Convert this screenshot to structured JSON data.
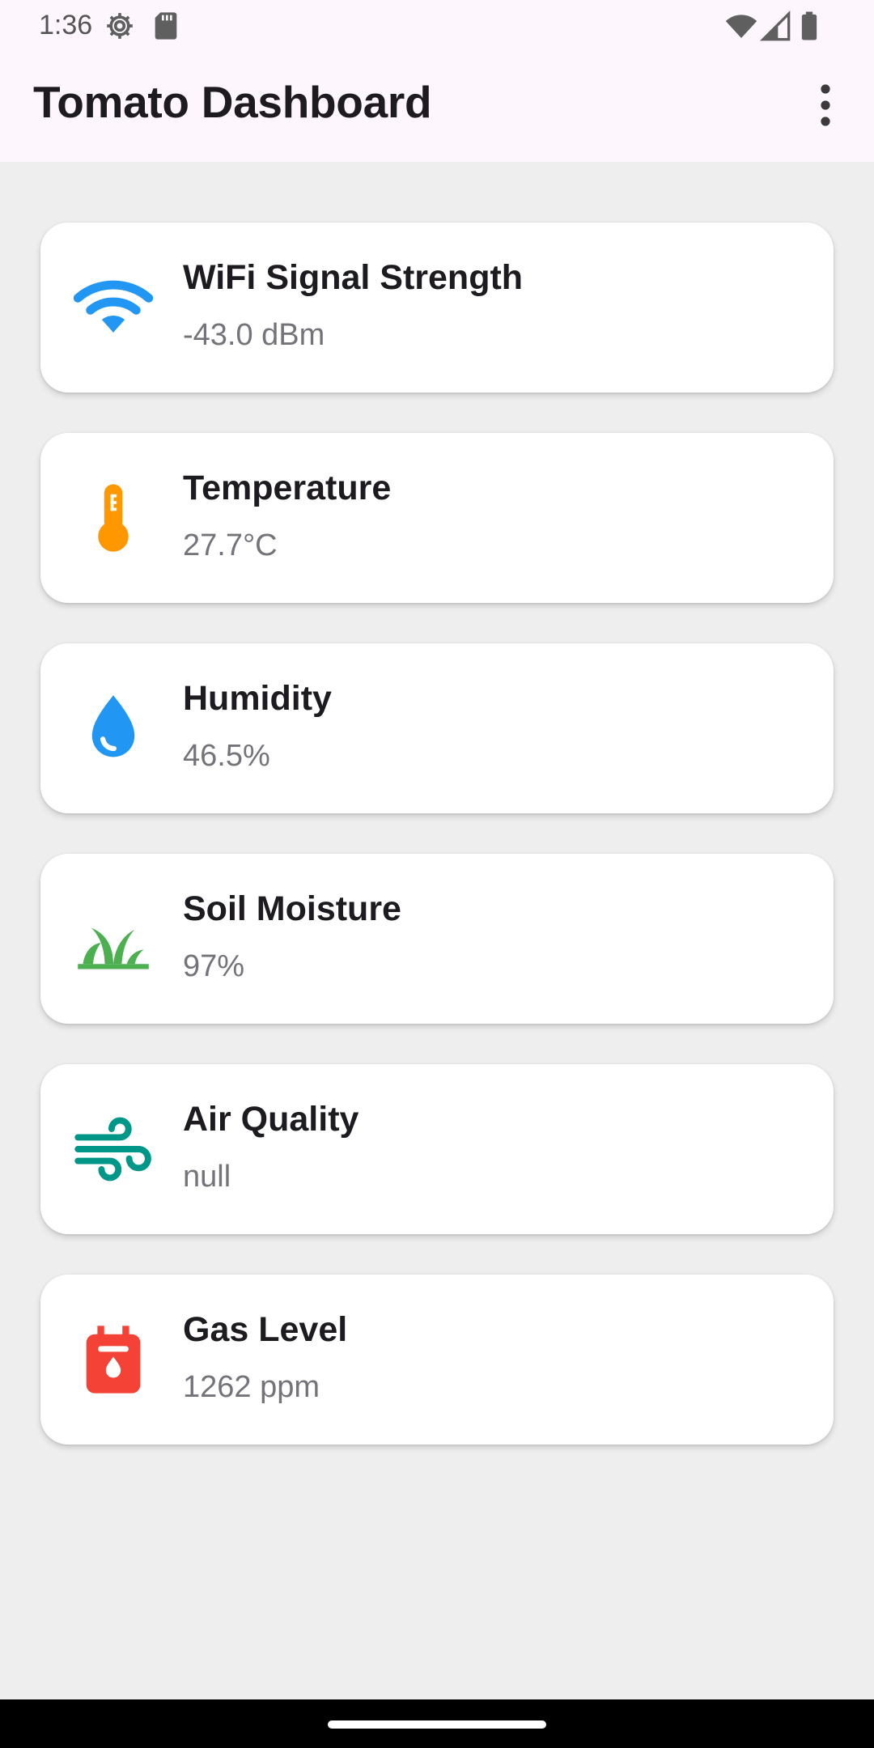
{
  "status_bar": {
    "time": "1:36",
    "icons": [
      "gear-icon",
      "sd-card-icon",
      "wifi-icon",
      "cell-signal-icon",
      "battery-icon"
    ]
  },
  "app_bar": {
    "title": "Tomato Dashboard",
    "menu_icon": "more-vertical-icon"
  },
  "colors": {
    "wifi": "#2196f3",
    "temperature": "#ff9800",
    "humidity": "#2196f3",
    "soil": "#4caf50",
    "air": "#009688",
    "gas": "#f44336"
  },
  "cards": [
    {
      "title": "WiFi Signal Strength",
      "value": "-43.0 dBm",
      "icon": "wifi-icon"
    },
    {
      "title": "Temperature",
      "value": "27.7°C",
      "icon": "thermometer-icon"
    },
    {
      "title": "Humidity",
      "value": "46.5%",
      "icon": "water-drop-icon"
    },
    {
      "title": "Soil Moisture",
      "value": "97%",
      "icon": "grass-icon"
    },
    {
      "title": "Air Quality",
      "value": "null",
      "icon": "air-icon"
    },
    {
      "title": "Gas Level",
      "value": "1262 ppm",
      "icon": "gas-meter-icon"
    }
  ]
}
